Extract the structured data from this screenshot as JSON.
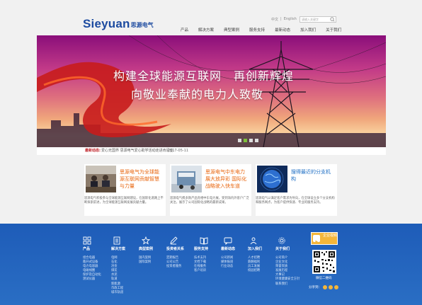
{
  "header": {
    "logo_en": "Sieyuan",
    "logo_cn": "思源电气",
    "lang": [
      "中文",
      "|",
      "English"
    ],
    "search_placeholder": "请输入关键字",
    "nav": [
      "产品",
      "解决方案",
      "典型案例",
      "服务支持",
      "最新动态",
      "加入我们",
      "关于我们"
    ]
  },
  "banner": {
    "line1": "构建全球能源互联网　再创新辉煌",
    "line2": "向敬业奉献的电力人致敬"
  },
  "ticker": {
    "label": "最新动态:",
    "text": "爱心无国界 思源电气爱心助学活动走进肯尼亚",
    "date": "2017-05-11"
  },
  "cards": [
    {
      "title": "思源电气为全球能源互联网贡献智慧与力量",
      "body": "思源电气积极参与全球能源互联网建设，在国际化道路上不断探索前进，为全球能源互联网发展贡献力量。"
    },
    {
      "title": "思源电气中东电力展大放异彩 国际化战略驶入快车道",
      "body": "思源电气携多款产品亮相中东电力展，受到海内外客户广泛关注，展示了公司国际化战略的最新成果。"
    },
    {
      "title": "搜得最近的分支机构",
      "body": "思源电气以满足客户需求为导向，在全球设立多个分支机构和服务网点，为客户提供快速、专业的服务支持。"
    }
  ],
  "footer": {
    "columns": [
      {
        "head": "产品",
        "items": [
          "组合电器",
          "敞开式设备",
          "电力电容器",
          "电磁线圈",
          "保护及自动化",
          "测试仪器"
        ]
      },
      {
        "head": "解决方案",
        "items": [
          "电网",
          "石化",
          "冶金",
          "煤炭",
          "水泥",
          "轨道",
          "新能源",
          "市政工程",
          "城市轨道"
        ]
      },
      {
        "head": "典型案例",
        "items": [
          "国内案例",
          "国际案例"
        ]
      },
      {
        "head": "投资者关系",
        "items": [
          "定期报告",
          "公司公告",
          "投资者服务"
        ]
      },
      {
        "head": "服务支持",
        "items": [
          "技术支持",
          "文档下载",
          "在线服务",
          "客户培训"
        ]
      },
      {
        "head": "最新动态",
        "items": [
          "公司新闻",
          "媒体报道",
          "行业动态"
        ]
      },
      {
        "head": "加入我们",
        "items": [
          "人才招聘",
          "薪酬福利",
          "员工发展",
          "校园招聘"
        ]
      },
      {
        "head": "关于我们",
        "items": [
          "公司简介",
          "企业文化",
          "荣誉资质",
          "发展历程",
          "大事记",
          "环境健康安全方针",
          "联系我们"
        ]
      }
    ],
    "video_label": "企业视频",
    "qr_caption": "微信二维码",
    "share_label": "分享到："
  },
  "colors": {
    "brand": "#1d4ba0",
    "footer": "#2a6ec4",
    "accent": "#e8640c",
    "ticker_label": "#c0272d"
  }
}
